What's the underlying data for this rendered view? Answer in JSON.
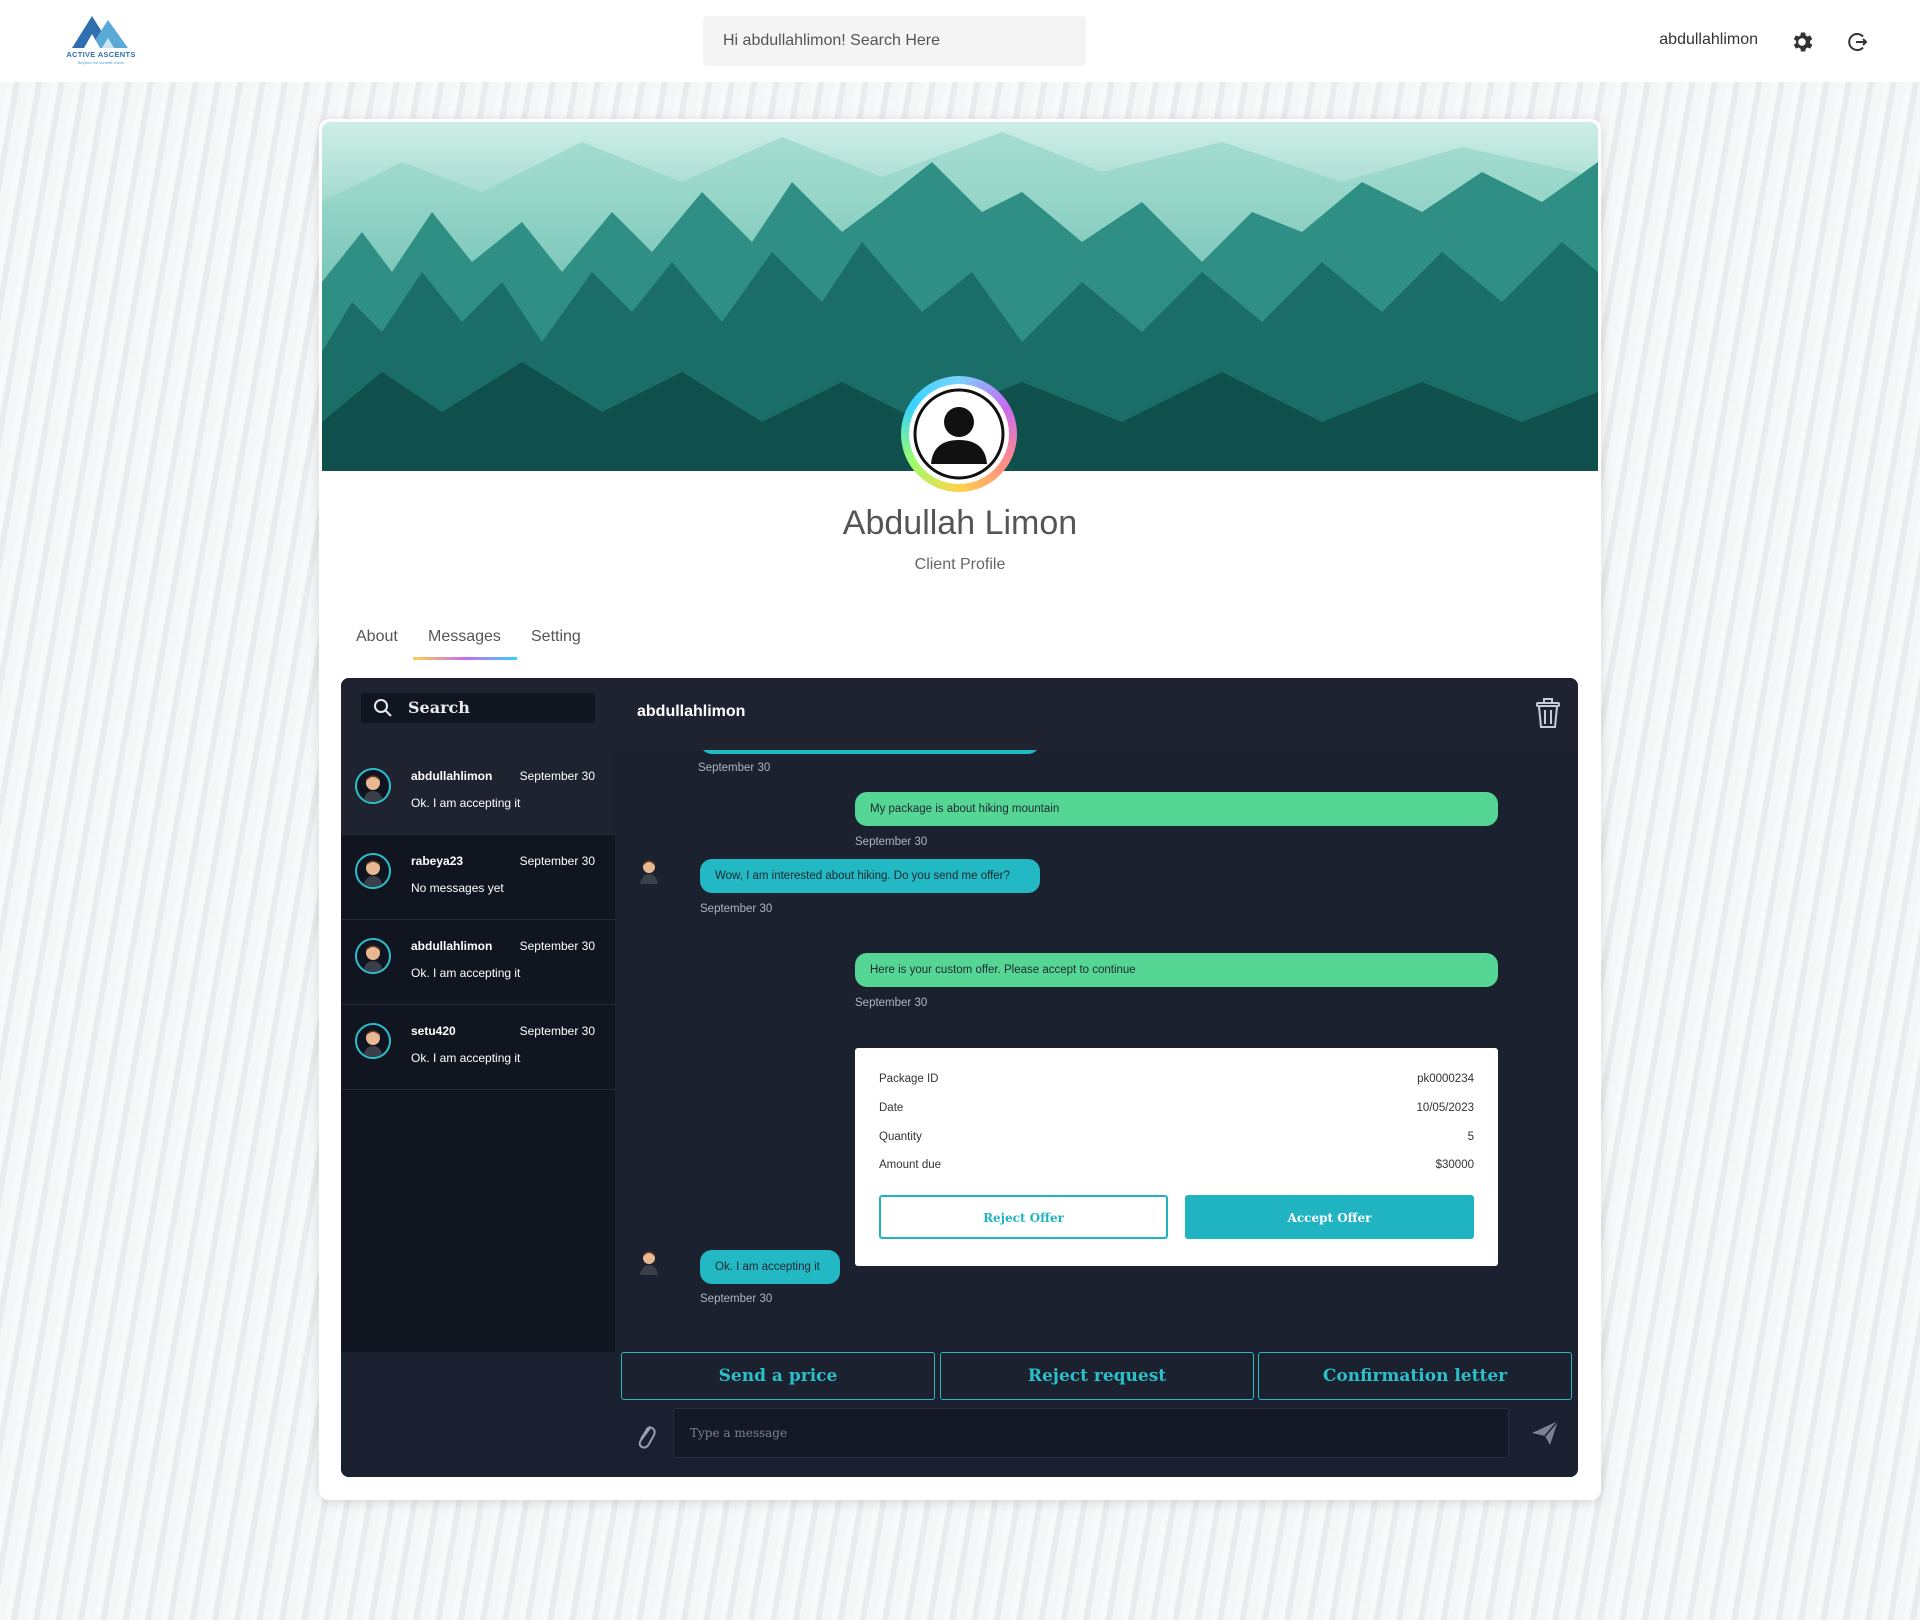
{
  "brand": {
    "name": "ACTIVE ASCENTS",
    "tagline": "Beyond the summit: travel"
  },
  "header": {
    "search_placeholder": "Hi abdullahlimon! Search Here",
    "username": "abdullahlimon"
  },
  "profile": {
    "name": "Abdullah Limon",
    "subtitle": "Client Profile",
    "tabs": [
      "About",
      "Messages",
      "Setting"
    ],
    "active_tab": "Messages"
  },
  "sidebar": {
    "search_label": "Search",
    "conversations": [
      {
        "name": "abdullahlimon",
        "date": "September 30",
        "last": "Ok. I am accepting it"
      },
      {
        "name": "rabeya23",
        "date": "September 30",
        "last": "No messages yet"
      },
      {
        "name": "abdullahlimon",
        "date": "September 30",
        "last": "Ok. I am accepting it"
      },
      {
        "name": "setu420",
        "date": "September 30",
        "last": "Ok. I am accepting it"
      }
    ]
  },
  "chat": {
    "title": "abdullahlimon",
    "messages": [
      {
        "from": "them",
        "text": "",
        "time": "September 30"
      },
      {
        "from": "me",
        "text": "My package is about hiking mountain",
        "time": "September 30"
      },
      {
        "from": "them",
        "text": "Wow, I am interested about hiking. Do you send me offer?",
        "time": "September 30"
      },
      {
        "from": "me",
        "text": "Here is your custom offer. Please accept to continue",
        "time": "September 30"
      },
      {
        "from": "them",
        "text": "Ok. I am accepting it",
        "time": "September 30"
      }
    ],
    "offer": {
      "rows": [
        {
          "label": "Package ID",
          "value": "pk0000234"
        },
        {
          "label": "Date",
          "value": "10/05/2023"
        },
        {
          "label": "Quantity",
          "value": "5"
        },
        {
          "label": "Amount due",
          "value": "$30000"
        }
      ],
      "reject_label": "Reject Offer",
      "accept_label": "Accept Offer"
    },
    "actions": [
      "Send a price",
      "Reject request",
      "Confirmation letter"
    ],
    "input_placeholder": "Type a message"
  },
  "colors": {
    "accent": "#20b4c2",
    "outgoing": "#56d695",
    "chat_bg": "#1c2130",
    "sidebar_bg": "#111520"
  }
}
